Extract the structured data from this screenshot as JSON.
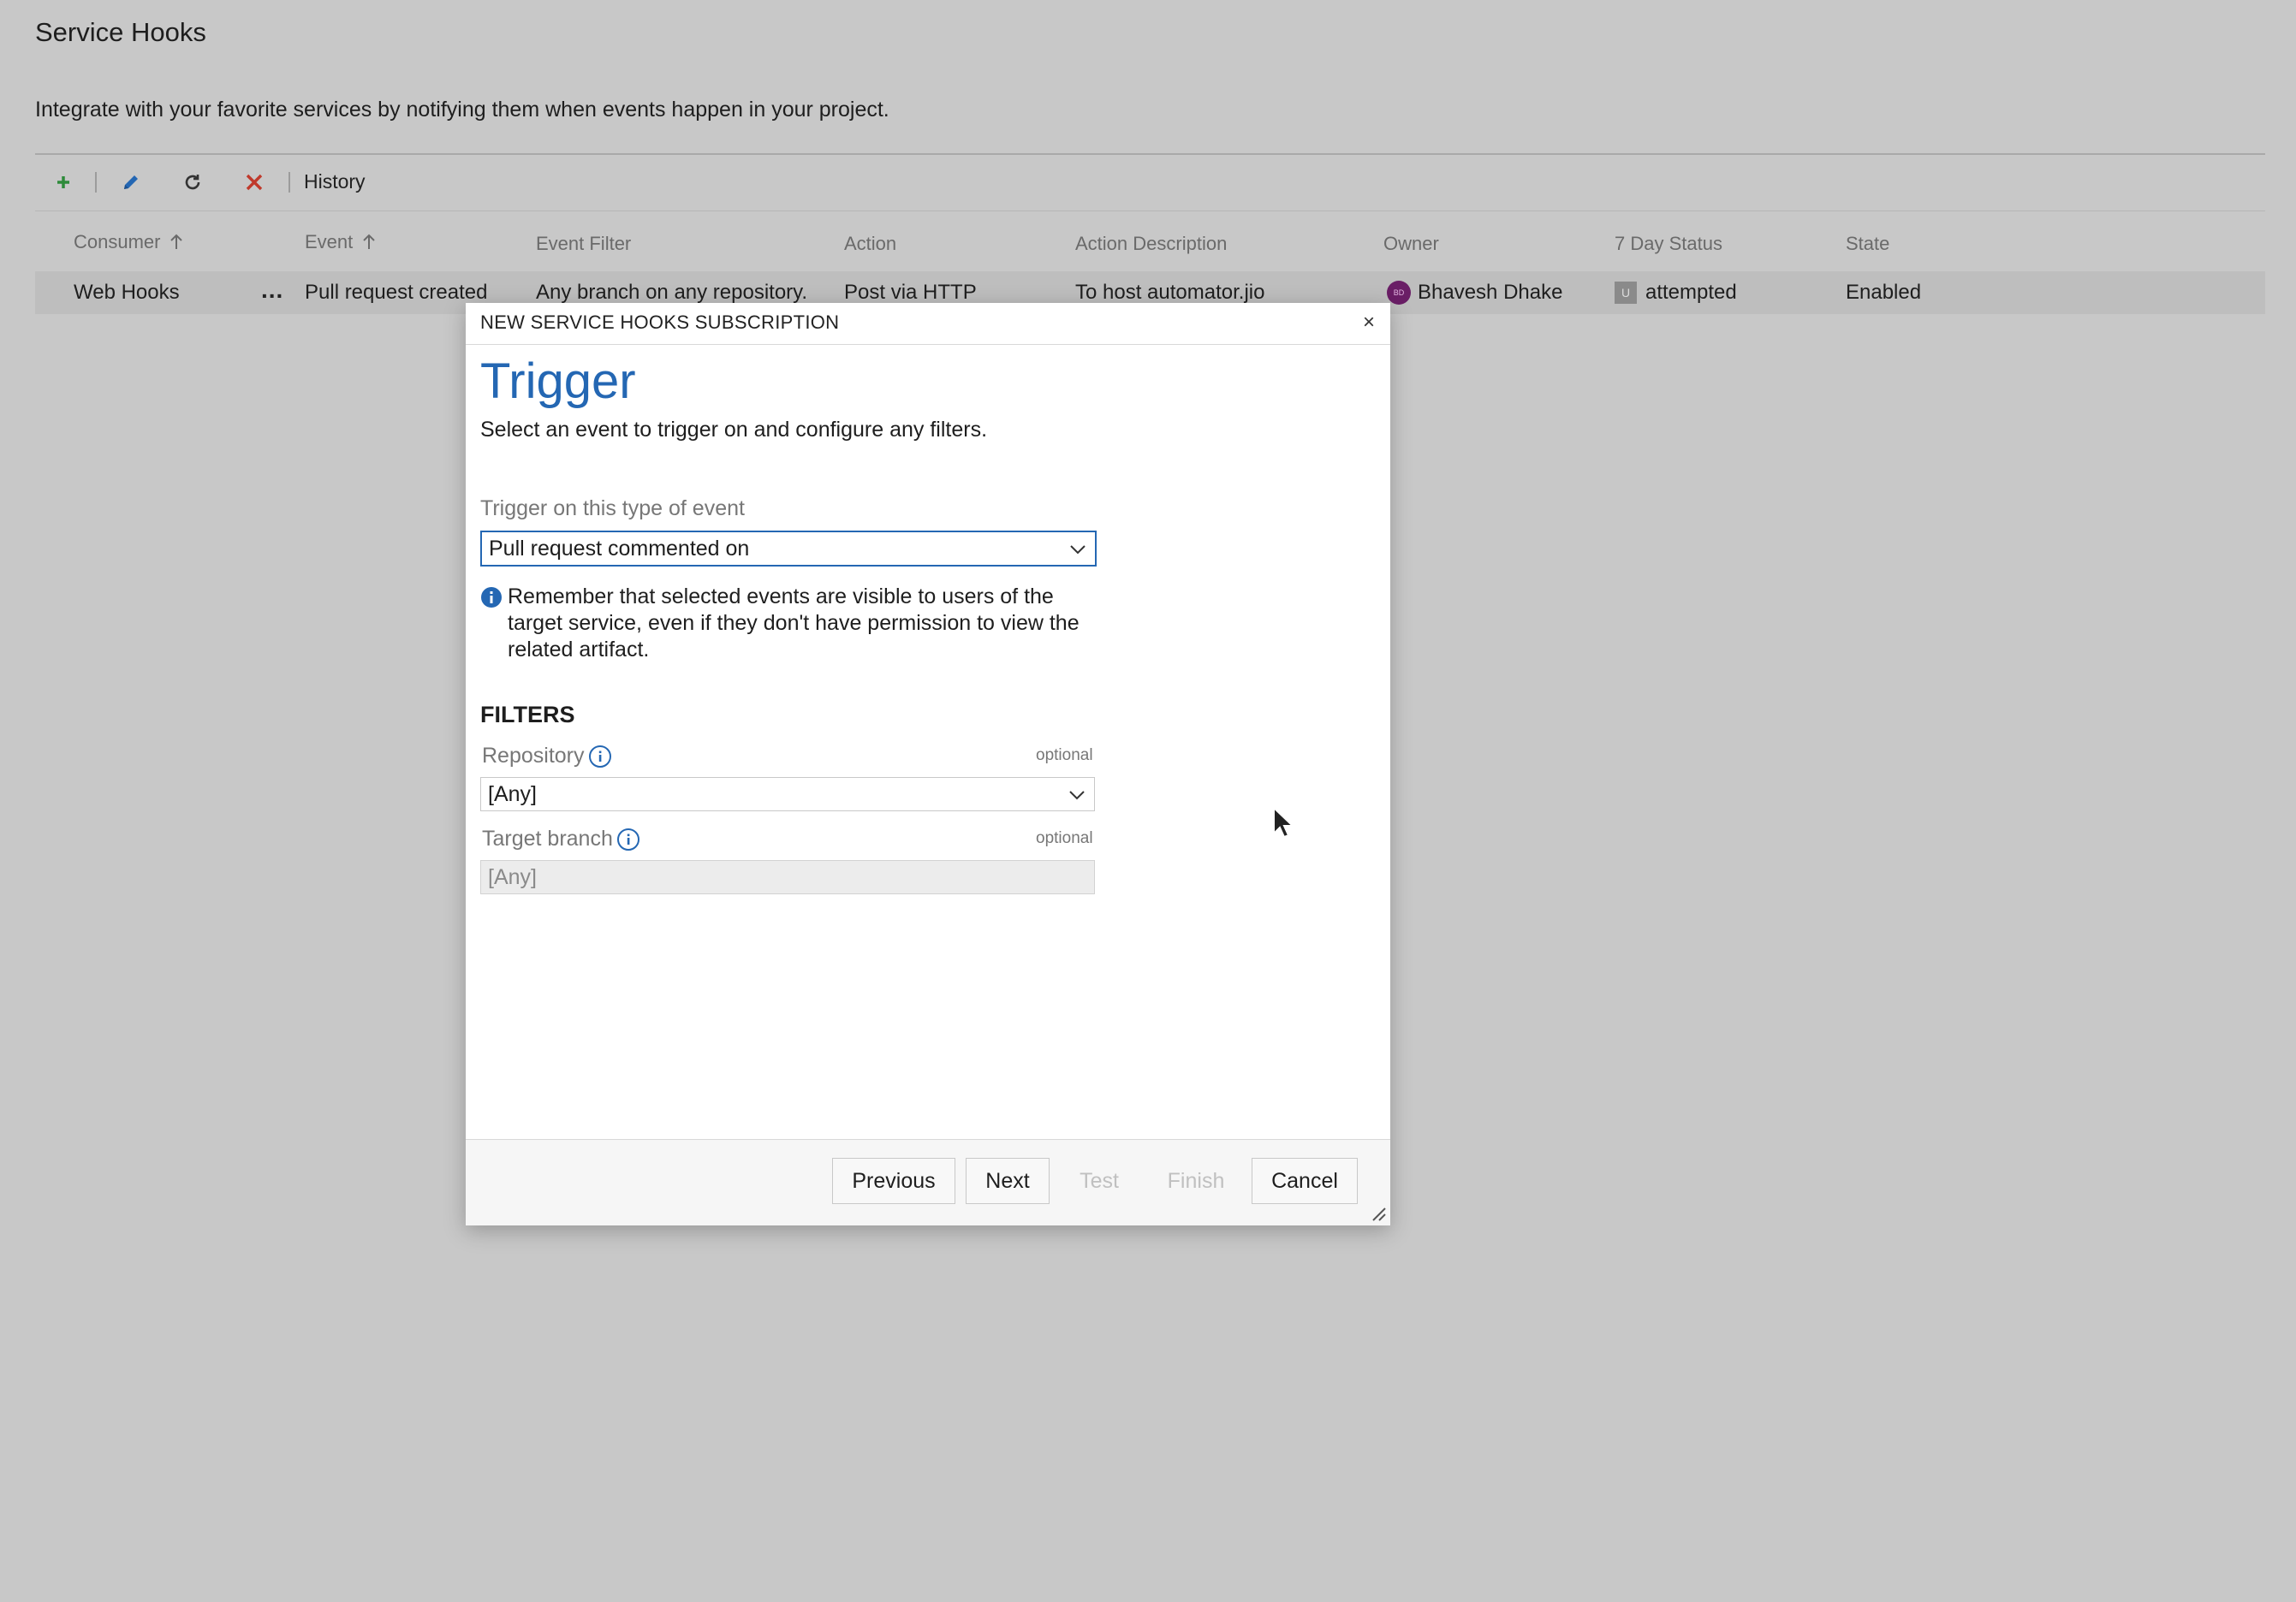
{
  "page": {
    "title": "Service Hooks",
    "description": "Integrate with your favorite services by notifying them when events happen in your project."
  },
  "toolbar": {
    "history_label": "History",
    "icons": [
      "add-icon",
      "edit-icon",
      "refresh-icon",
      "delete-icon"
    ]
  },
  "table": {
    "columns": {
      "consumer": "Consumer",
      "event": "Event",
      "event_filter": "Event Filter",
      "action": "Action",
      "action_description": "Action Description",
      "owner": "Owner",
      "status": "7 Day Status",
      "state": "State"
    },
    "rows": [
      {
        "consumer": "Web Hooks",
        "ellipsis": "...",
        "event": "Pull request created",
        "event_filter": "Any branch on any repository.",
        "action": "Post via HTTP",
        "action_description": "To host automator.jio",
        "owner_initials": "BD",
        "owner": "Bhavesh Dhake",
        "status_icon_letter": "U",
        "status": "attempted",
        "state": "Enabled"
      }
    ]
  },
  "dialog": {
    "title": "NEW SERVICE HOOKS SUBSCRIPTION",
    "close_label": "×",
    "heading": "Trigger",
    "subheading": "Select an event to trigger on and configure any filters.",
    "event_label": "Trigger on this type of event",
    "event_value": "Pull request commented on",
    "info_note": "Remember that selected events are visible to users of the target service, even if they don't have permission to view the related artifact.",
    "filters_heading": "FILTERS",
    "repository_label": "Repository",
    "repository_optional": "optional",
    "repository_value": "[Any]",
    "branch_label": "Target branch",
    "branch_optional": "optional",
    "branch_value": "[Any]",
    "buttons": {
      "previous": "Previous",
      "next": "Next",
      "test": "Test",
      "finish": "Finish",
      "cancel": "Cancel"
    }
  },
  "colors": {
    "accent": "#2467b3",
    "overlay_background": "#c8c8c8",
    "delete": "#c0392b",
    "add": "#2e8b3a"
  }
}
